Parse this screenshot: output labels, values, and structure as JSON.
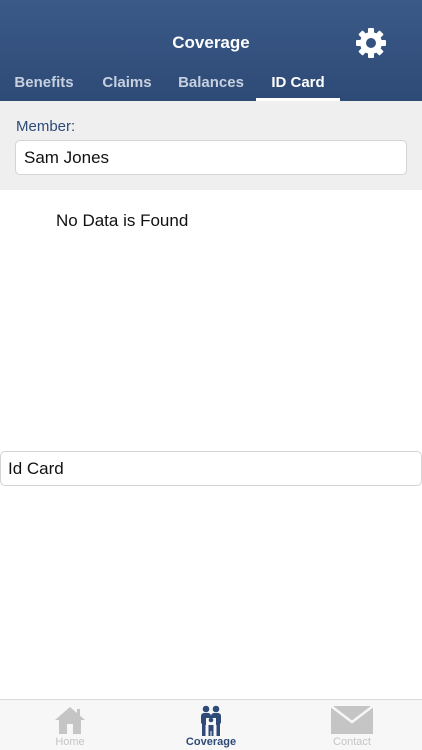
{
  "header": {
    "title": "Coverage",
    "settings_icon": "gear-icon"
  },
  "tabs": [
    {
      "label": "Benefits",
      "active": false
    },
    {
      "label": "Claims",
      "active": false
    },
    {
      "label": "Balances",
      "active": false
    },
    {
      "label": "ID Card",
      "active": true
    }
  ],
  "member": {
    "label": "Member:",
    "value": "Sam Jones"
  },
  "content": {
    "message": "No Data is Found",
    "id_card_field": "Id Card"
  },
  "bottom_nav": [
    {
      "label": "Home",
      "icon": "home-icon",
      "active": false
    },
    {
      "label": "Coverage",
      "icon": "family-icon",
      "active": true
    },
    {
      "label": "Contact",
      "icon": "envelope-icon",
      "active": false
    }
  ],
  "colors": {
    "header_bg": "#2e4a76",
    "active_tab": "#ffffff",
    "inactive_tab": "#c6d0df",
    "panel_bg": "#efefef",
    "nav_active": "#2e4a76",
    "nav_inactive": "#c5c5c5"
  }
}
